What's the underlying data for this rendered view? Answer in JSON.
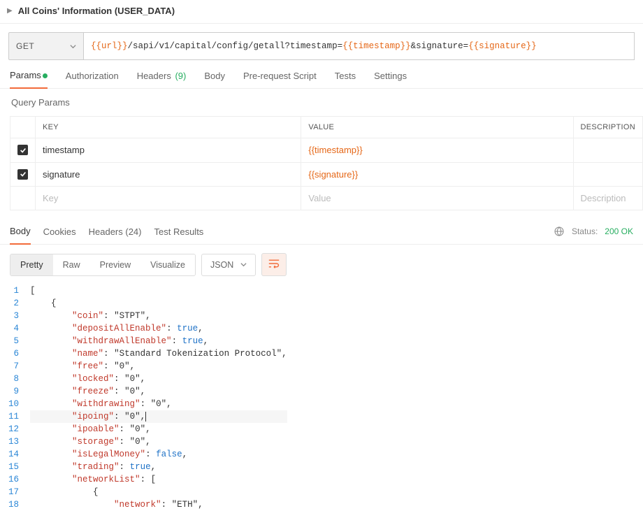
{
  "header": {
    "title": "All Coins' Information (USER_DATA)"
  },
  "request": {
    "method": "GET",
    "url_prefix": "{{url}}",
    "url_path": "/sapi/v1/capital/config/getall?timestamp=",
    "url_ts_var": "{{timestamp}}",
    "url_sig_sep": "&signature=",
    "url_sig_var": "{{signature}}"
  },
  "tabs": {
    "params": "Params",
    "auth": "Authorization",
    "headers": "Headers",
    "headers_count": "(9)",
    "body": "Body",
    "prereq": "Pre-request Script",
    "tests": "Tests",
    "settings": "Settings"
  },
  "query_params_label": "Query Params",
  "param_headers": {
    "key": "KEY",
    "value": "VALUE",
    "description": "DESCRIPTION"
  },
  "param_rows": [
    {
      "key": "timestamp",
      "value": "{{timestamp}}"
    },
    {
      "key": "signature",
      "value": "{{signature}}"
    }
  ],
  "param_placeholders": {
    "key": "Key",
    "value": "Value",
    "description": "Description"
  },
  "resp_tabs": {
    "body": "Body",
    "cookies": "Cookies",
    "headers": "Headers",
    "headers_count": "(24)",
    "tests": "Test Results"
  },
  "status": {
    "label": "Status:",
    "value": "200 OK"
  },
  "view": {
    "pretty": "Pretty",
    "raw": "Raw",
    "preview": "Preview",
    "visualize": "Visualize",
    "lang": "JSON"
  },
  "code": {
    "lines": [
      "[",
      "    {",
      "        \"coin\": \"STPT\",",
      "        \"depositAllEnable\": true,",
      "        \"withdrawAllEnable\": true,",
      "        \"name\": \"Standard Tokenization Protocol\",",
      "        \"free\": \"0\",",
      "        \"locked\": \"0\",",
      "        \"freeze\": \"0\",",
      "        \"withdrawing\": \"0\",",
      "        \"ipoing\": \"0\",",
      "        \"ipoable\": \"0\",",
      "        \"storage\": \"0\",",
      "        \"isLegalMoney\": false,",
      "        \"trading\": true,",
      "        \"networkList\": [",
      "            {",
      "                \"network\": \"ETH\","
    ]
  }
}
